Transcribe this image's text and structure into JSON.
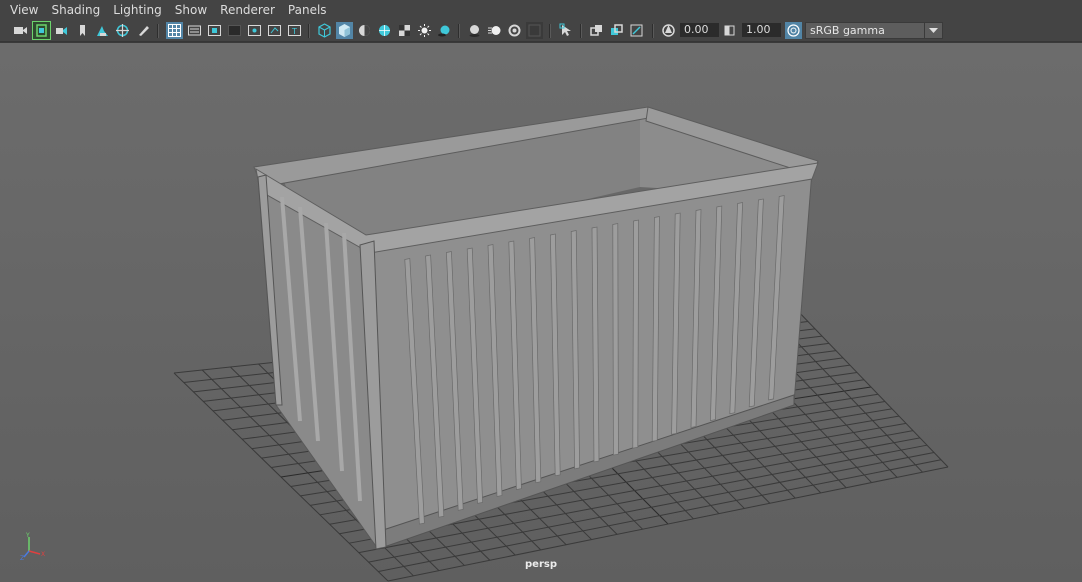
{
  "menu": {
    "items": [
      {
        "label": "View"
      },
      {
        "label": "Shading"
      },
      {
        "label": "Lighting"
      },
      {
        "label": "Show"
      },
      {
        "label": "Renderer"
      },
      {
        "label": "Panels"
      }
    ]
  },
  "toolbar": {
    "exposure_value": "0.00",
    "gamma_value": "1.00",
    "color_space": "sRGB gamma",
    "icons": [
      "select-camera-icon",
      "camera-attributes-icon",
      "bookmark-icon",
      "image-plane-icon",
      "2d-pan-zoom-icon",
      "grease-pencil-icon",
      "grid-icon",
      "film-gate-icon",
      "resolution-gate-icon",
      "gate-mask-icon",
      "field-chart-icon",
      "safe-action-icon",
      "safe-title-icon",
      "wireframe-icon",
      "smooth-shade-icon",
      "use-default-material-icon",
      "wireframe-on-shaded-icon",
      "textured-icon",
      "use-all-lights-icon",
      "shadows-icon",
      "ambient-occlusion-icon",
      "motion-blur-icon",
      "multisample-aa-icon",
      "depth-of-field-icon",
      "isolate-select-icon",
      "xray-icon",
      "xray-active-components-icon",
      "xray-joints-icon",
      "exposure-icon",
      "gamma-icon",
      "color-management-icon"
    ],
    "colors": {
      "accent": "#5285a6",
      "icon_cyan": "#3fc8d9",
      "icon_light": "#d8d8d8"
    }
  },
  "viewport": {
    "camera_name": "persp",
    "background": "#686868",
    "axis_labels": {
      "y": "Y",
      "x": "X",
      "z": "Z"
    }
  }
}
